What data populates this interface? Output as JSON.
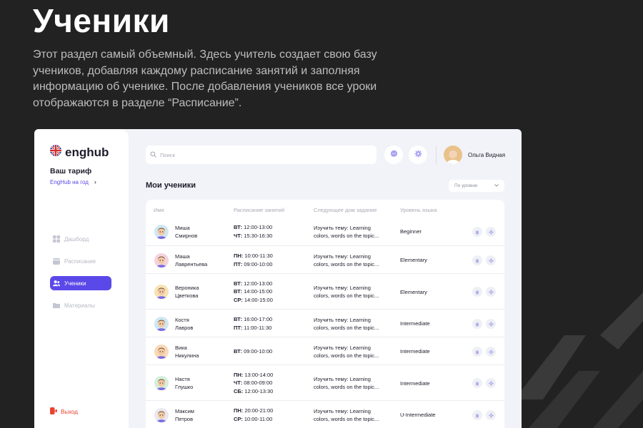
{
  "headline": "Ученики",
  "intro": "Этот раздел самый объемный. Здесь учитель создает свою базу учеников, добавляя каждому расписание занятий и заполняя информацию об ученике. После добавления учеников все уроки отображаются в разделе “Расписание”.",
  "app": {
    "logo": "enghub",
    "plan": {
      "title": "Ваш тариф",
      "link": "EngHub на год"
    },
    "nav": [
      {
        "label": "Дашборд",
        "icon": "dashboard-icon"
      },
      {
        "label": "Расписание",
        "icon": "calendar-icon"
      },
      {
        "label": "Ученики",
        "icon": "users-icon",
        "active": true
      },
      {
        "label": "Материалы",
        "icon": "folder-icon"
      }
    ],
    "logout": "Выход",
    "search": {
      "placeholder": "Поиск",
      "value": ""
    },
    "user": {
      "name": "Ольга Видная"
    },
    "section_title": "Мои ученики",
    "filter": {
      "selected": "По уровню"
    },
    "table": {
      "headers": [
        "Имя",
        "Расписание занятий",
        "Следующее дом задание",
        "Уровень языка"
      ],
      "rows": [
        {
          "first": "Миша",
          "last": "Смирнов",
          "schedule": [
            [
              "ВТ:",
              "12:00-13:00"
            ],
            [
              "ЧТ:",
              "15:30-16:30"
            ]
          ],
          "hw1": "Изучить тему: Learning",
          "hw2": "colors, words on the topic...",
          "level": "Beginner",
          "avatar_bg": "#cfe7f2"
        },
        {
          "first": "Маша",
          "last": "Лаврентьева",
          "schedule": [
            [
              "ПН:",
              "10:00-11:30"
            ],
            [
              "ПТ:",
              "09:00-10:00"
            ]
          ],
          "hw1": "Изучить тему: Learning",
          "hw2": "colors, words on the topic...",
          "level": "Elementary",
          "avatar_bg": "#f4d3de"
        },
        {
          "first": "Вероника",
          "last": "Цветкова",
          "schedule": [
            [
              "ВТ:",
              "12:00-13:00"
            ],
            [
              "ВТ:",
              "14:00-15:00"
            ],
            [
              "СР:",
              "14:00-15:00"
            ]
          ],
          "hw1": "Изучить тему: Learning",
          "hw2": "colors, words on the topic...",
          "level": "Elementary",
          "avatar_bg": "#f6e3b5"
        },
        {
          "first": "Костя",
          "last": "Лавров",
          "schedule": [
            [
              "ВТ:",
              "16:00-17:00"
            ],
            [
              "ПТ:",
              "11:00-11:30"
            ]
          ],
          "hw1": "Изучить тему: Learning",
          "hw2": "colors, words on the topic...",
          "level": "Intermediate",
          "avatar_bg": "#cfe7f2"
        },
        {
          "first": "Вика",
          "last": "Никулина",
          "schedule": [
            [
              "ВТ:",
              "09:00-10:00"
            ]
          ],
          "hw1": "Изучить тему: Learning",
          "hw2": "colors, words on the topic...",
          "level": "Intermediate",
          "avatar_bg": "#f8d9b8"
        },
        {
          "first": "Настя",
          "last": "Глушко",
          "schedule": [
            [
              "ПН:",
              "13:00-14:00"
            ],
            [
              "ЧТ:",
              "08:00-09:00"
            ],
            [
              "СБ:",
              "12:00-13:30"
            ]
          ],
          "hw1": "Изучить тему: Learning",
          "hw2": "colors, words on the topic...",
          "level": "Intermediate",
          "avatar_bg": "#d5eedc"
        },
        {
          "first": "Максим",
          "last": "Петров",
          "schedule": [
            [
              "ПН:",
              "20:00-21:00"
            ],
            [
              "СР:",
              "10:00-11:00"
            ]
          ],
          "hw1": "Изучить тему: Learning",
          "hw2": "colors, words on the topic...",
          "level": "U-Intermediate",
          "avatar_bg": "#e8e8ee"
        }
      ]
    }
  },
  "colors": {
    "accent": "#5b48e8",
    "logout": "#e8432f",
    "background": "#222222"
  }
}
